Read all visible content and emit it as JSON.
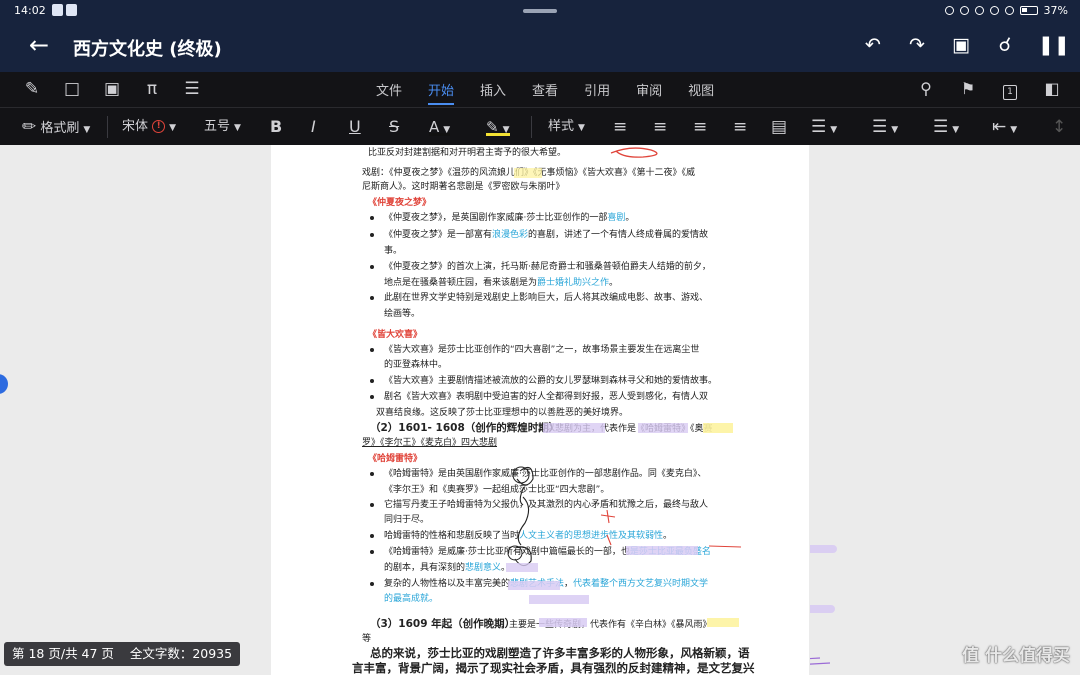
{
  "status_bar": {
    "time": "14:02",
    "battery": "37%"
  },
  "header": {
    "title": "西方文化史 (终极)"
  },
  "ribbon": {
    "tabs": [
      "文件",
      "开始",
      "插入",
      "查看",
      "引用",
      "审阅",
      "视图"
    ],
    "active_tab": "开始",
    "page_num": "1"
  },
  "format_bar": {
    "format_painter": "格式刷",
    "font": "宋体",
    "font_size": "五号",
    "bold": "B",
    "italic": "I",
    "underline": "U",
    "strike": "S",
    "font_color": "A",
    "styles": "样式"
  },
  "colors": {
    "accent": "#4a8df0",
    "header_bg": "#17233d",
    "heading_red": "#e0443a",
    "link_blue": "#2aa6d8"
  },
  "doc": {
    "line1": "比亚反对封建割据和对开明君主寄予的很大希望。",
    "drama1": "戏剧：《仲夏夜之梦》《温莎的风流娘儿们》《无事烦恼》《皆大欢喜》《第十二夜》《威",
    "drama2": "尼斯商人》。这时期著名悲剧是《罗密欧与朱丽叶》",
    "h_msnd": "《仲夏夜之梦》",
    "msnd1": "《仲夏夜之梦》，是英国剧作家威廉·莎士比亚创作的一部",
    "msnd1_hl": "喜剧",
    "msnd1_end": "。",
    "msnd2a": "《仲夏夜之梦》是一部富有",
    "msnd2_hl": "浪漫色彩",
    "msnd2b": "的喜剧，讲述了一个有情人终成眷属的爱情故",
    "msnd2c": "事。",
    "msnd3a": "《仲夏夜之梦》的首次上演，托马斯·赫尼奇爵士和骚桑普顿伯爵夫人结婚的前夕，",
    "msnd3b": "地点是在骚桑普顿庄园，看来该剧是为",
    "msnd3_hl": "爵士婚礼助兴之作",
    "msnd3_end": "。",
    "msnd4a": "此剧在世界文学史特别是戏剧史上影响巨大，后人将其改编成电影、故事、游戏、",
    "msnd4b": "绘画等。",
    "h_ayli": "《皆大欢喜》",
    "ayli1a": "《皆大欢喜》是莎士比亚创作的“四大喜剧”之一，故事场景主要发生在远离尘世",
    "ayli1b": "的亚登森林中。",
    "ayli2": "《皆大欢喜》主要剧情描述被流放的公爵的女儿罗瑟琳到森林寻父和她的爱情故事。",
    "ayli3a": "剧名《皆大欢喜》表明剧中受迫害的好人全都得到好报，恶人受到感化，有情人双",
    "ayli3b": "双喜结良缘。这反映了莎士比亚理想中的以善胜恶的美好境界。",
    "sec2a": "（2）1601- 1608（创作的辉煌时期）",
    "sec2b": "：以悲剧为主，代表作是《哈姆雷特》《奥赛",
    "sec2c": "罗》《李尔王》《麦克白》四大悲剧",
    "h_ham": "《哈姆雷特》",
    "ham1a": "《哈姆雷特》是由英国剧作家威廉·莎士比亚创作的一部悲剧作品。同《麦克白》、",
    "ham1b": "《李尔王》和《奥赛罗》一起组成莎士比亚“四大悲剧”。",
    "ham2a": "它描写丹麦王子哈姆雷特为父报仇，及其激烈的内心矛盾和犹豫之后，最终与敌人",
    "ham2b": "同归于尽。",
    "ham3a": "哈姆雷特的性格和悲剧反映了当时",
    "ham3_hl": "人文主义者的思想进步性及其软弱性",
    "ham3_end": "。",
    "ham4a": "《哈姆雷特》是威廉·莎士比亚所有戏剧中篇幅最长的一部，也",
    "ham4_hl": "是莎士比亚最负盛名",
    "ham4b": "的剧本，具有深刻的",
    "ham4b_hl": "悲剧意义",
    "ham4b_end": "。",
    "ham5a": "复杂的人物性格以及丰富完美的",
    "ham5_hl": "悲剧艺术手法",
    "ham5_mid": "，",
    "ham5_hl2": "代表着整个西方文艺复兴时期文学",
    "ham5b": "的最高成就。",
    "sec3a": "（3）1609 年起（创作晚期）",
    "sec3b": "：主要是一些传奇剧，代表作有《辛白林》《暴风雨》",
    "sec3c": "等",
    "sum1": "总的来说，莎士比亚的戏剧塑造了许多丰富多彩的人物形象，风格新颖，语",
    "sum2": "言丰富，背景广阔，揭示了现实社会矛盾，具有强烈的反封建精神，是文艺复兴"
  },
  "footer": {
    "page_status": "第 18 页/共 47 页",
    "word_count": "全文字数：20935",
    "watermark": "值 什么值得买"
  }
}
